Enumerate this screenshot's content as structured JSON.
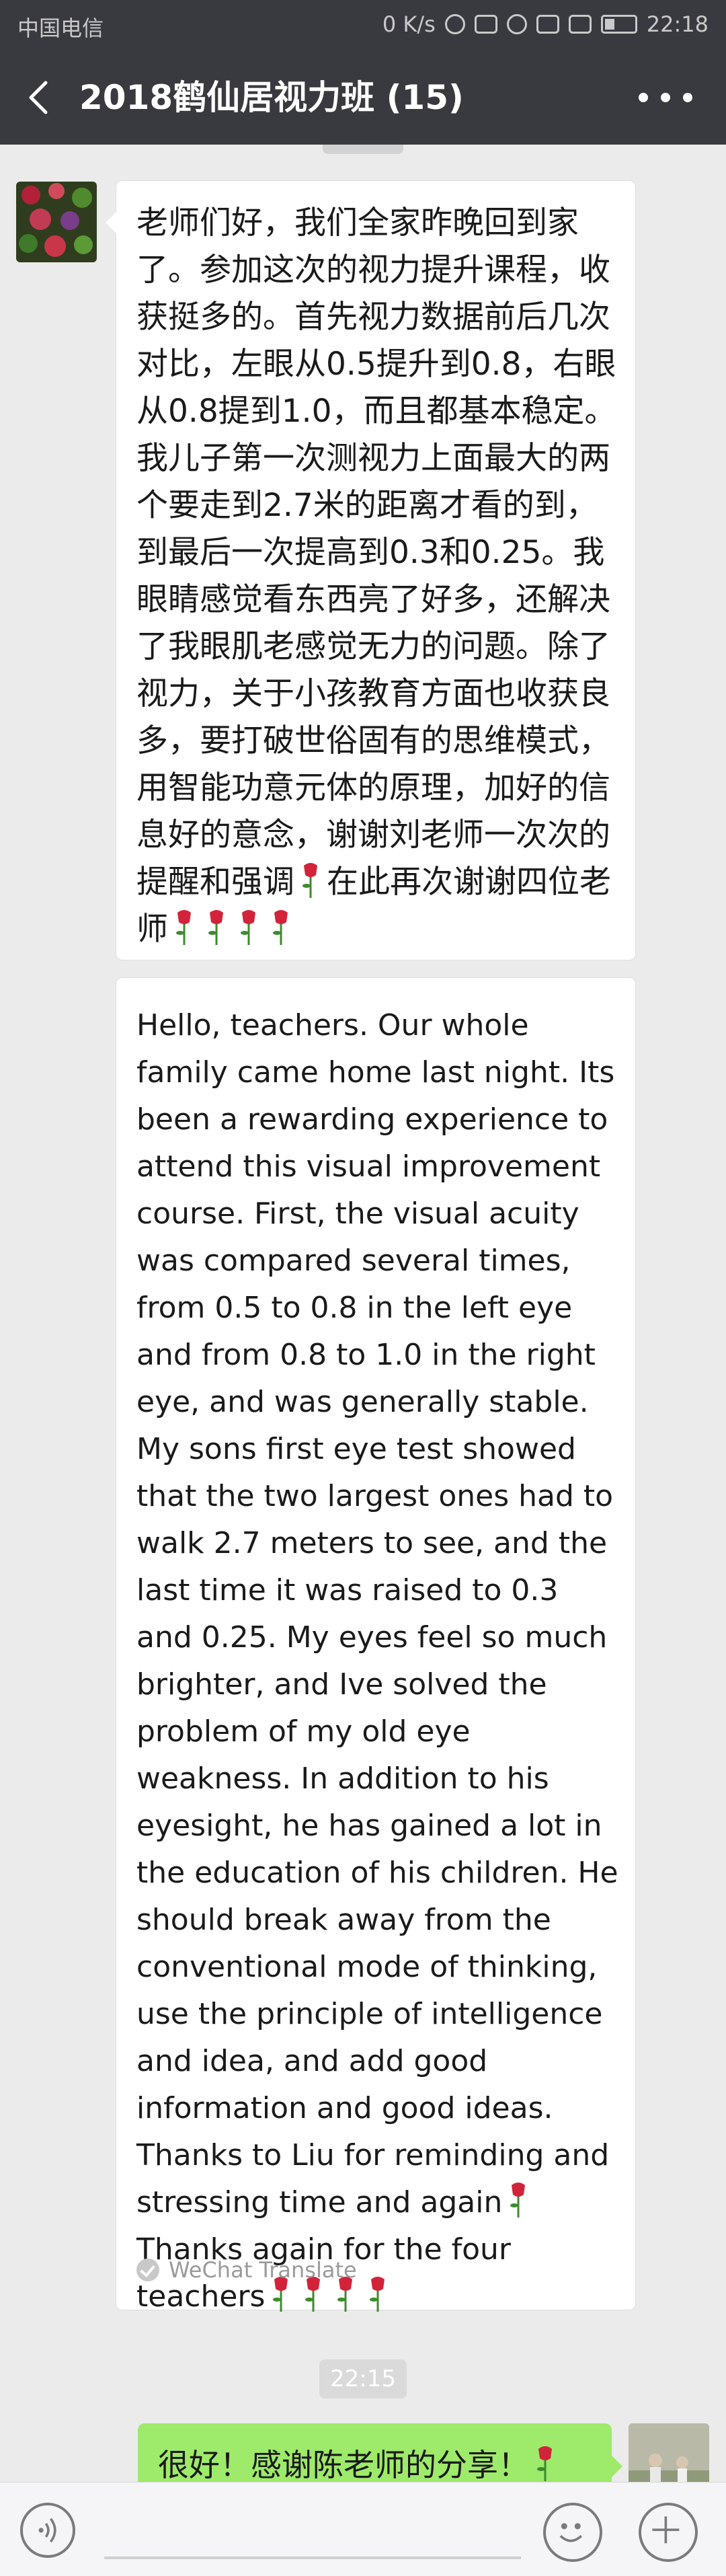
{
  "status_bar": {
    "carrier": "中国电信",
    "speed": "0 K/s",
    "time": "22:18"
  },
  "header": {
    "title": "2018鹤仙居视力班 (15)"
  },
  "messages": {
    "chinese_text": "老师们好，我们全家昨晚回到家了。参加这次的视力提升课程，收获挺多的。首先视力数据前后几次对比，左眼从0.5提升到0.8，右眼从0.8提到1.0，而且都基本稳定。我儿子第一次测视力上面最大的两个要走到2.7米的距离才看的到，到最后一次提高到0.3和0.25。我眼睛感觉看东西亮了好多，还解决了我眼肌老感觉无力的问题。除了视力，关于小孩教育方面也收获良多，要打破世俗固有的思维模式，用智能功意元体的原理，加好的信息好的意念，谢谢刘老师一次次的提醒和强调",
    "chinese_text_2": "在此再次谢谢四位老师",
    "english_text": "Hello, teachers. Our whole family came home last night. Its been a rewarding experience to attend this visual improvement course. First, the visual acuity was compared several times, from 0.5 to 0.8 in the left eye and from 0.8 to 1.0 in the right eye, and was generally stable. My sons first eye test showed that the two largest ones had to walk 2.7 meters to see, and the last time it was raised to 0.3 and 0.25. My eyes feel so much brighter, and Ive solved the problem of my old eye weakness. In addition to his eyesight, he has gained a lot in the education of his children. He should break away from the conventional mode of thinking, use the principle of intelligence and idea, and add good information and good ideas. Thanks to Liu for reminding and stressing time and again",
    "english_text_2": "Thanks again for the four teachers",
    "translate_label": "WeChat Translate",
    "timestamp": "22:15",
    "my_message": "很好！感谢陈老师的分享！"
  },
  "icons": {
    "rose": "rose-emoji-icon",
    "back": "back-arrow-icon",
    "more": "more-dots-icon",
    "voice": "voice-icon",
    "emoji": "emoji-icon",
    "plus": "plus-icon"
  }
}
